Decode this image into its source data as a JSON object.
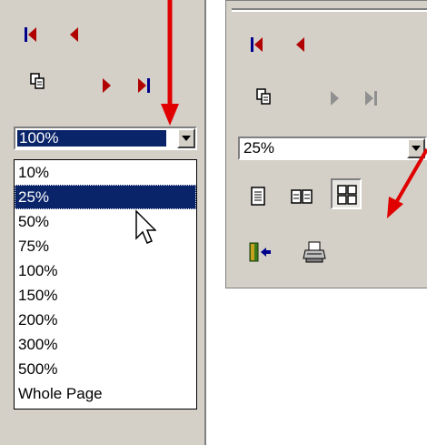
{
  "left_toolbar": {
    "zoom_value": "100%",
    "zoom_options": [
      "10%",
      "25%",
      "50%",
      "75%",
      "100%",
      "150%",
      "200%",
      "300%",
      "500%",
      "Whole Page"
    ],
    "highlighted_option": "25%"
  },
  "right_toolbar": {
    "zoom_value": "25%"
  },
  "icons": {
    "first_page": "first-page-icon",
    "previous_page": "previous-page-icon",
    "next_page": "next-page-icon",
    "last_page": "last-page-icon",
    "copy": "copy-icon",
    "one_page": "one-page-icon",
    "two_pages": "two-pages-icon",
    "multiple_pages": "multiple-pages-icon",
    "close": "close-icon",
    "print": "print-icon"
  },
  "colors": {
    "nav_active": "#00008b",
    "nav_red": "#b00000",
    "nav_disabled": "#909090",
    "selection": "#0a246a",
    "annotation_arrow": "#e00000",
    "toolbar_bg": "#d4d0c8"
  }
}
